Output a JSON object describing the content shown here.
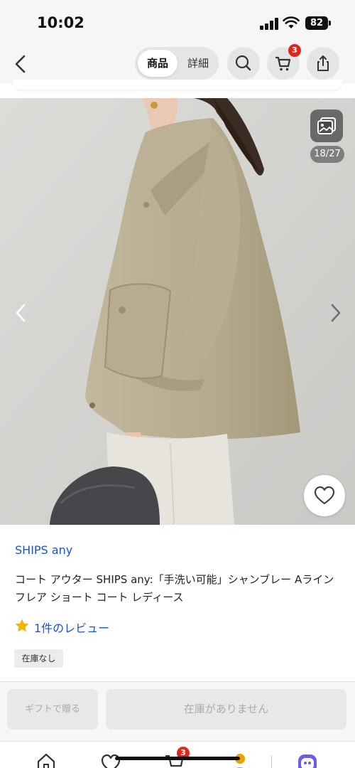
{
  "status_bar": {
    "time": "10:02",
    "battery": "82"
  },
  "header": {
    "segments": [
      {
        "label": "商品"
      },
      {
        "label": "詳細"
      }
    ],
    "cart_count": "3"
  },
  "gallery": {
    "counter": "18/27"
  },
  "product": {
    "brand": "SHIPS any",
    "title": "コート アウター SHIPS any:「手洗い可能」シャンブレー Aライン フレア ショート コート レディース",
    "review_text": "1件のレビュー",
    "stock_tag": "在庫なし"
  },
  "actions": {
    "gift_label": "ギフトで贈る",
    "out_of_stock_label": "在庫がありません"
  },
  "tab_bar": {
    "cart_count": "3"
  },
  "colors": {
    "link": "#1a55c4",
    "badge": "#e0251b",
    "star": "#f5b400"
  },
  "icons": [
    "back-icon",
    "search-icon",
    "cart-icon",
    "share-icon",
    "gallery-icon",
    "chevron-left-icon",
    "chevron-right-icon",
    "heart-icon",
    "star-icon",
    "home-icon",
    "favorites-icon",
    "tab-cart-icon",
    "tab-profile-icon",
    "assistant-icon"
  ]
}
